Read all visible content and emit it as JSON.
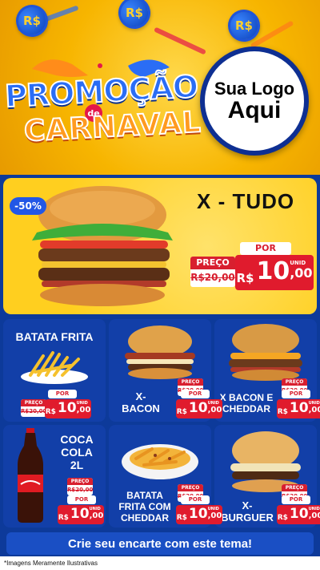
{
  "header": {
    "coin_label": "R$",
    "title_line1": "PROMOÇÃO",
    "title_de": "de",
    "title_line2": "CARNAVAL",
    "logo_line1": "Sua Logo",
    "logo_line2": "Aqui"
  },
  "featured": {
    "discount": "-50%",
    "name": "X - TUDO",
    "preco_label": "PREÇO",
    "old_price": "R$20,00",
    "por_label": "POR",
    "currency": "R$",
    "price_int": "10",
    "price_cents": ",00",
    "unit": "UNID"
  },
  "products": [
    {
      "name": "BATATA FRITA",
      "preco_label": "PREÇO",
      "old_price": "R$20,00",
      "por_label": "POR",
      "currency": "R$",
      "price_int": "10",
      "price_cents": ",00",
      "unit": "UNID"
    },
    {
      "name_l1": "X-",
      "name_l2": "BACON",
      "preco_label": "PREÇO",
      "old_price": "R$20,00",
      "por_label": "POR",
      "currency": "R$",
      "price_int": "10",
      "price_cents": ",00",
      "unit": "UNID"
    },
    {
      "name_l1": "X BACON E",
      "name_l2": "CHEDDAR",
      "preco_label": "PREÇO",
      "old_price": "R$20,00",
      "por_label": "POR",
      "currency": "R$",
      "price_int": "10",
      "price_cents": ",00",
      "unit": "UNID"
    },
    {
      "name_l1": "COCA",
      "name_l2": "COLA",
      "name_l3": "2L",
      "preco_label": "PREÇO",
      "old_price": "R$20,00",
      "por_label": "POR",
      "currency": "R$",
      "price_int": "10",
      "price_cents": ",00",
      "unit": "UNID"
    },
    {
      "name_l1": "BATATA",
      "name_l2": "FRITA COM",
      "name_l3": "CHEDDAR",
      "preco_label": "PREÇO",
      "old_price": "R$20,00",
      "por_label": "POR",
      "currency": "R$",
      "price_int": "10",
      "price_cents": ",00",
      "unit": "UNID"
    },
    {
      "name_l1": "X-",
      "name_l2": "BURGUER",
      "preco_label": "PREÇO",
      "old_price": "R$20,00",
      "por_label": "POR",
      "currency": "R$",
      "price_int": "10",
      "price_cents": ",00",
      "unit": "UNID"
    }
  ],
  "cta": "Crie seu encarte com este tema!",
  "footer": "*Imagens Meramente Ilustrativas",
  "colors": {
    "brand_blue": "#0d3a9a",
    "accent_yellow": "#ffcf1f",
    "price_red": "#e01b2d"
  }
}
